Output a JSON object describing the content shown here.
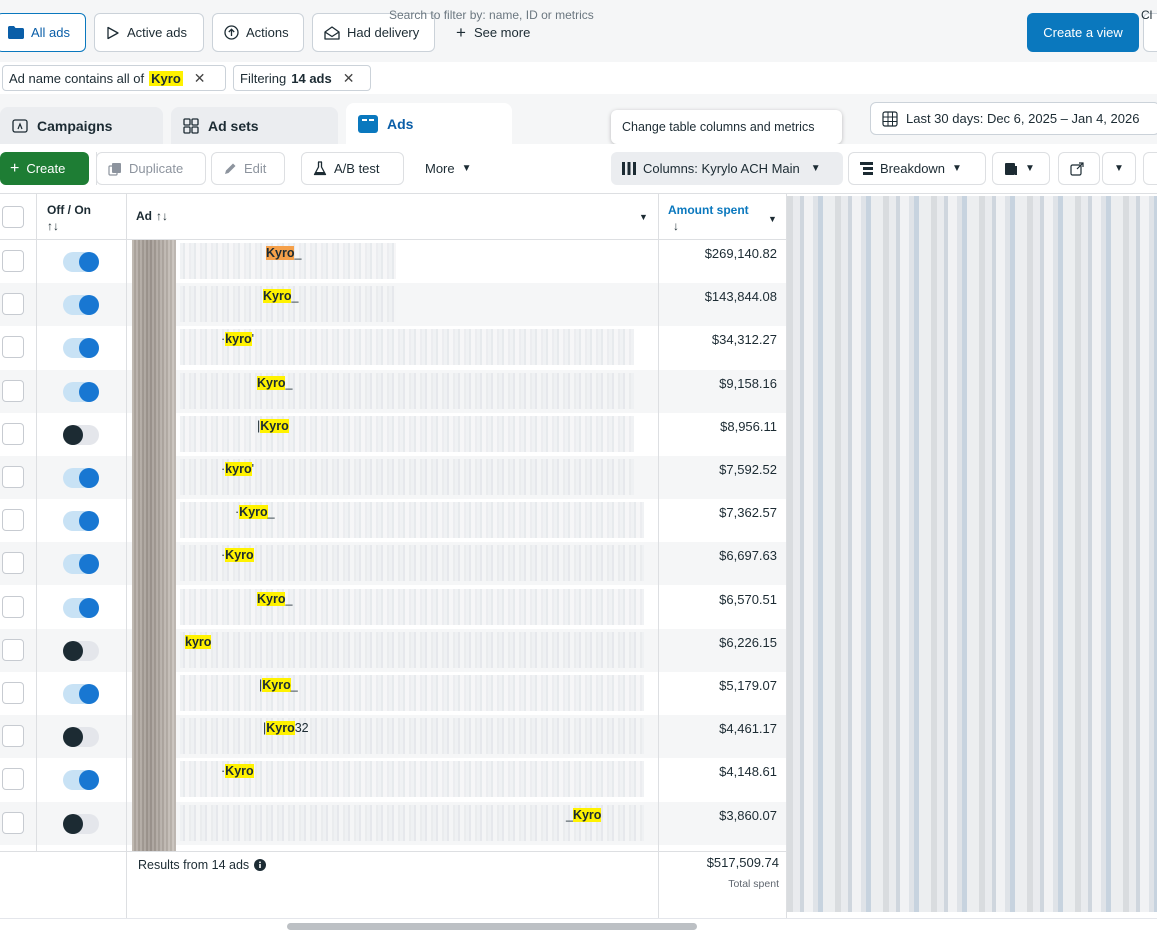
{
  "topbar": {
    "views": [
      {
        "label": "All ads",
        "icon": "folder-icon",
        "active": true
      },
      {
        "label": "Active ads",
        "icon": "play-outline-icon",
        "active": false
      },
      {
        "label": "Actions",
        "icon": "arrow-up-circle-icon",
        "active": false
      },
      {
        "label": "Had delivery",
        "icon": "envelope-open-icon",
        "active": false
      }
    ],
    "see_more": "See more",
    "create_view": "Create a view"
  },
  "filters": {
    "chip1_prefix": "Ad name contains all of",
    "chip1_term": "Kyro",
    "chip2_prefix": "Filtering",
    "chip2_count": "14 ads",
    "search_placeholder": "Search to filter by: name, ID or metrics",
    "clear": "Cl"
  },
  "levels": {
    "campaigns": "Campaigns",
    "ad_sets": "Ad sets",
    "ads": "Ads"
  },
  "tooltip": "Change table columns and metrics",
  "date_range": "Last 30 days: Dec 6, 2025 – Jan 4, 2026",
  "toolbar": {
    "create": "Create",
    "duplicate": "Duplicate",
    "edit": "Edit",
    "ab_test": "A/B test",
    "more": "More",
    "columns": "Columns: Kyrylo ACH Main",
    "breakdown": "Breakdown"
  },
  "table": {
    "headers": {
      "off_on": "Off / On",
      "sort_icon": "↑↓",
      "ad": "Ad",
      "amount_spent": "Amount spent",
      "amount_sort": "↓"
    },
    "rows": [
      {
        "prefix": "",
        "kyro": "Kyro",
        "suffix": "_",
        "amount": "$269,140.82",
        "on": true
      },
      {
        "prefix": "",
        "kyro": "Kyro",
        "suffix": "_",
        "amount": "$143,844.08",
        "on": true
      },
      {
        "prefix": "·",
        "kyro": "kyro",
        "suffix": "'",
        "amount": "$34,312.27",
        "on": true
      },
      {
        "prefix": "",
        "kyro": "Kyro",
        "suffix": "_",
        "amount": "$9,158.16",
        "on": true
      },
      {
        "prefix": "|",
        "kyro": "Kyro",
        "suffix": "",
        "amount": "$8,956.11",
        "on": false
      },
      {
        "prefix": "·",
        "kyro": "kyro",
        "suffix": "'",
        "amount": "$7,592.52",
        "on": true
      },
      {
        "prefix": "·",
        "kyro": "Kyro",
        "suffix": "_",
        "amount": "$7,362.57",
        "on": true
      },
      {
        "prefix": "·",
        "kyro": "Kyro",
        "suffix": "",
        "amount": "$6,697.63",
        "on": true
      },
      {
        "prefix": "",
        "kyro": "Kyro",
        "suffix": "_",
        "amount": "$6,570.51",
        "on": true
      },
      {
        "prefix": "",
        "kyro": "kyro",
        "suffix": "",
        "amount": "$6,226.15",
        "on": false
      },
      {
        "prefix": "|",
        "kyro": "Kyro",
        "suffix": "_",
        "amount": "$5,179.07",
        "on": true
      },
      {
        "prefix": "|",
        "kyro": "Kyro",
        "suffix": "32",
        "amount": "$4,461.17",
        "on": false
      },
      {
        "prefix": "·",
        "kyro": "Kyro",
        "suffix": "",
        "amount": "$4,148.61",
        "on": true
      },
      {
        "prefix": "_",
        "kyro": "Kyro",
        "suffix": "",
        "amount": "$3,860.07",
        "on": false
      }
    ],
    "footer": {
      "results": "Results from 14 ads",
      "total": "$517,509.74",
      "total_label": "Total spent"
    }
  },
  "colors": {
    "primary": "#0a78be",
    "create_green": "#1e7d34",
    "highlight": "#fff200",
    "highlight_current": "#f5a04a"
  }
}
